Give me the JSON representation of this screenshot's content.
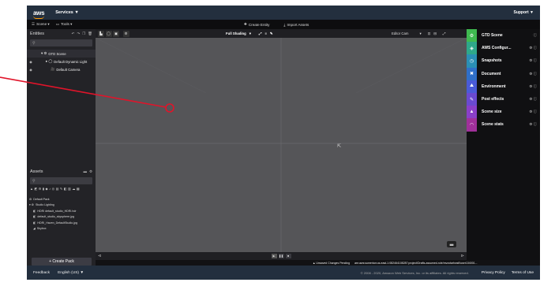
{
  "aws": {
    "logo": "aws",
    "services": "Services ▼",
    "support": "Support ▼"
  },
  "menubar": {
    "scene": "Scene ▾",
    "tools": "Tools ▾",
    "create_entity": "Create Entity",
    "import_assets": "Import Assets",
    "help": "Help ▾",
    "publish": "Publish ▾"
  },
  "entities": {
    "title": "Entities",
    "tree": [
      {
        "label": "GTD Scene",
        "eye": "",
        "indent": 8
      },
      {
        "label": "Default Dynamic Light",
        "eye": "◉",
        "indent": 14
      },
      {
        "label": "Default Camera",
        "eye": "◉",
        "indent": 14
      }
    ]
  },
  "assets": {
    "title": "Assets",
    "items": [
      "Default Pack",
      "Studio Lighting",
      "HDRI default_studio_HDRI.hdr",
      "default_studio_skysphere.jpg",
      "HDRI_Haven_DefaultStudio.jpg",
      "Skybox"
    ],
    "create_pack": "+ Create Pack",
    "complete": "Complete"
  },
  "viewport": {
    "shading": "Full Shading",
    "camera": "Editor Cam"
  },
  "right_panel": {
    "rows": [
      {
        "label": "GTD Scene",
        "color": "#3fb950",
        "icon": "⚙",
        "icons": "ⓘ"
      },
      {
        "label": "AWS Configur...",
        "color": "#2ea88a",
        "icon": "◈",
        "icons": "⚙ ⓘ"
      },
      {
        "label": "Snapshots",
        "color": "#2a8fb5",
        "icon": "◷",
        "icons": "⚙ ⓘ"
      },
      {
        "label": "Document",
        "color": "#2f6fc8",
        "icon": "✖",
        "icons": "⚙ ⓘ"
      },
      {
        "label": "Environment",
        "color": "#4a5bd8",
        "icon": "⛰",
        "icons": "⚙ ⓘ"
      },
      {
        "label": "Post effects",
        "color": "#6a4ad0",
        "icon": "✎",
        "icons": "⚙ ⓘ"
      },
      {
        "label": "Scene size",
        "color": "#8a3fc8",
        "icon": "▲",
        "icons": "⚙ ⓘ"
      },
      {
        "label": "Scene stats",
        "color": "#a0309a",
        "icon": "◠",
        "icons": "⚙ ⓘ"
      }
    ]
  },
  "status": {
    "unsaved": "▲ Unsaved Changes Pending",
    "path": "arn:aws:sumerian:us-east-1:082464108287:project/Drafts-assumed-role/mvzotarhwsfl/user104001..."
  },
  "footer": {
    "feedback": "Feedback",
    "language": "English (US) ▼",
    "copyright": "© 2008 - 2020, Amazon Web Services, Inc. or its affiliates. All rights reserved.",
    "privacy": "Privacy Policy",
    "terms": "Terms of Use"
  }
}
